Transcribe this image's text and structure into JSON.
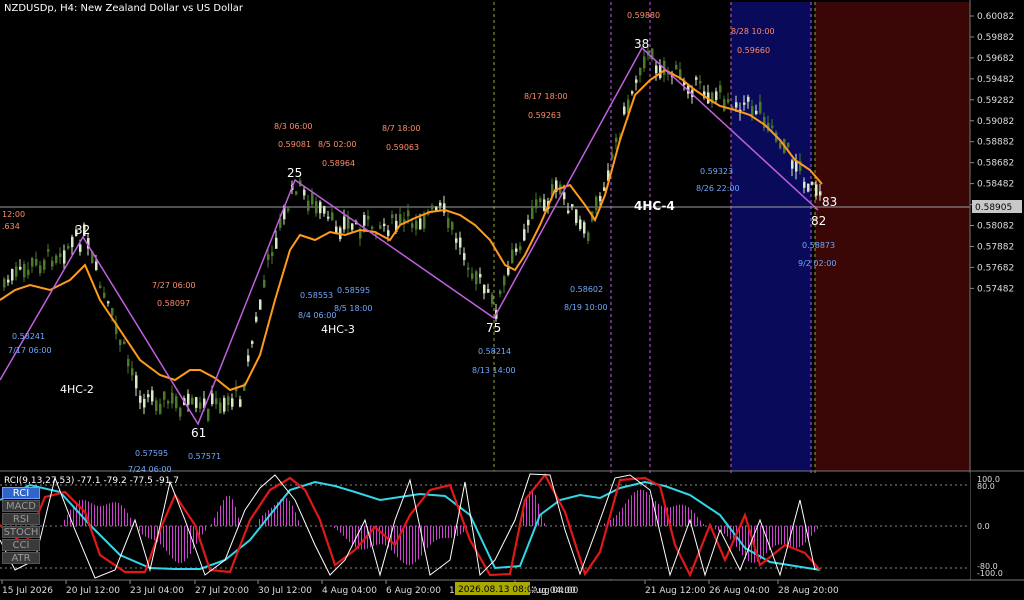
{
  "title": "NZDUSDp, H4:  New Zealand Dollar vs US Dollar",
  "current_price": "0.58905",
  "price_axis": [
    "0.60082",
    "0.59882",
    "0.59682",
    "0.59482",
    "0.59282",
    "0.59082",
    "0.58882",
    "0.58682",
    "0.58482",
    "0.58282",
    "0.58082",
    "0.57882",
    "0.57682",
    "0.57482"
  ],
  "time_axis": [
    "15 Jul 2026",
    "20 Jul 12:00",
    "23 Jul 04:00",
    "27 Jul 20:00",
    "30 Jul 12:00",
    "4 Aug 04:00",
    "6 Aug 20:00",
    "18 Aug 04:00",
    "21 Aug 12:00",
    "26 Aug 04:00",
    "28 Aug 20:00"
  ],
  "time_axis_partial": [
    "1",
    "Aug 04:00"
  ],
  "time_cursor_label": "2026.08.13 08:00",
  "rci_header": "RCI(9,13,27,53) -77.1 -79.2 -77.5 -91.7",
  "rci_axis": [
    "100.0",
    "80.0",
    "0.0",
    "-80.0",
    "-100.0"
  ],
  "indicator_tabs": [
    "RCI",
    "MACD",
    "RSI",
    "STOCH",
    "CCI",
    "ATR"
  ],
  "active_tab": "RCI",
  "wave_labels": [
    "32",
    "61",
    "25",
    "75",
    "38",
    "82",
    "83"
  ],
  "wave_tags": [
    "4HC-2",
    "4HC-3",
    "4HC-4"
  ],
  "left_cut": [
    "12:00",
    ".634"
  ],
  "orange_notes": [
    "7/27 06:00",
    "0.58097",
    "8/3 06:00",
    "0.59081",
    "8/5 02:00",
    "0.58964",
    "8/7 18:00",
    "0.59063",
    "8/17 18:00",
    "0.59263",
    "0.59880",
    "8/28 10:00",
    "0.59660"
  ],
  "blue_notes": [
    "0.58241",
    "7/17 06:00",
    "0.57595",
    "7/24 06:00",
    "0.57571",
    "0.58553",
    "8/4 06:00",
    "0.58595",
    "8/5 18:00",
    "0.58214",
    "8/13 14:00",
    "0.58602",
    "8/19 10:00",
    "0.59323",
    "8/26 22:00",
    "0.58873",
    "9/2 02:00"
  ],
  "colors": {
    "background": "#000000",
    "zigzag": "#c060e0",
    "ma": "#ff9a1a",
    "up_candle": "#d8e8c8",
    "down_candle": "#4a7a2a",
    "blue_zone": "#0a0a5a",
    "red_zone": "#3a0606",
    "rci_fast": "#ffffff",
    "rci_mid": "#e01818",
    "rci_slow": "#33d6e8",
    "rci_hist": "#d040d0"
  }
}
